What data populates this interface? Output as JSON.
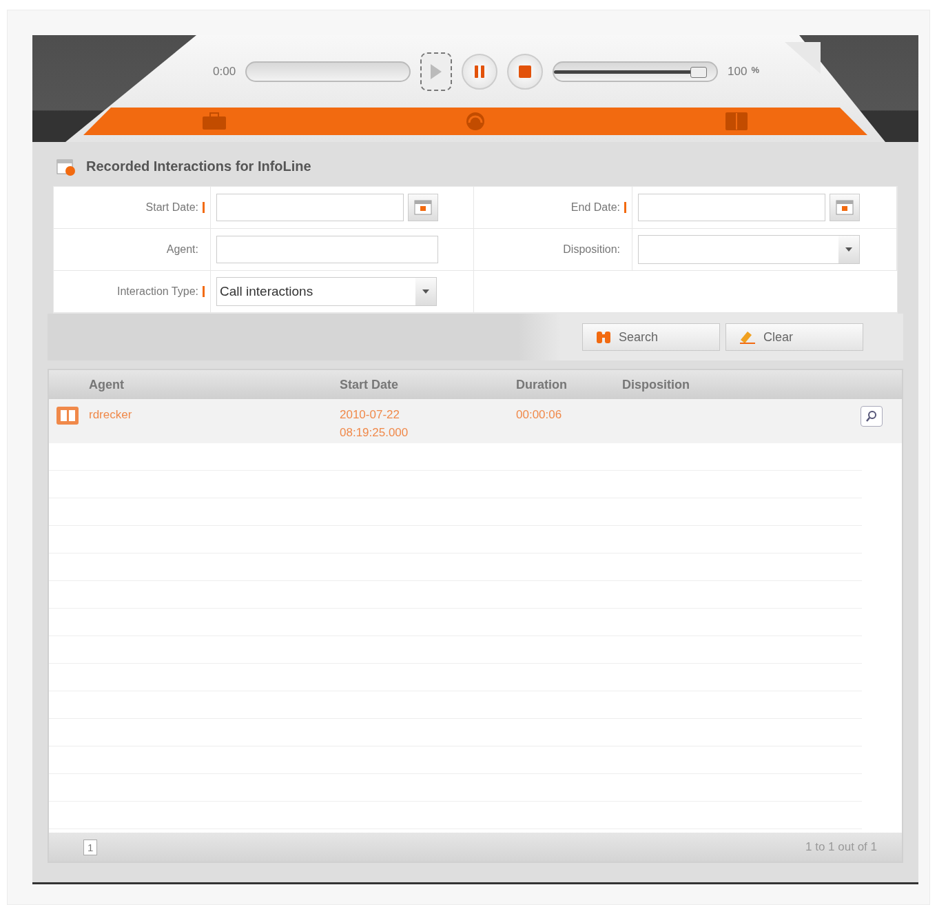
{
  "player": {
    "time": "0:00",
    "volume": {
      "level": 0.93
    },
    "volume_reading": "100",
    "volume_unit": "%"
  },
  "nav_tabs": [
    {
      "kind": "briefcase"
    },
    {
      "kind": "headset"
    },
    {
      "kind": "book"
    }
  ],
  "title": "Recorded Interactions for InfoLine",
  "form": {
    "rows": [
      [
        {
          "label": "Start Date:",
          "required": true,
          "kind": "date"
        },
        {
          "label": "End Date:",
          "required": true,
          "kind": "date"
        }
      ],
      [
        {
          "label": "Agent:",
          "required": false,
          "kind": "text"
        },
        {
          "label": "Disposition:",
          "required": false,
          "kind": "select"
        }
      ],
      [
        {
          "label": "Interaction Type:",
          "required": true,
          "kind": "select",
          "value": "Call interactions"
        }
      ]
    ]
  },
  "buttons": [
    {
      "kind": "search",
      "label": "Search"
    },
    {
      "kind": "clear",
      "label": "Clear"
    }
  ],
  "table": {
    "columns": [
      "Agent",
      "Start Date",
      "Duration",
      "Disposition"
    ],
    "rows": [
      {
        "agent": "rdrecker",
        "start_date": "2010-07-22 08:19:25.000",
        "duration": "00:00:06"
      }
    ]
  },
  "pager": {
    "page": "1",
    "summary": "1 to 1 out of 1"
  }
}
